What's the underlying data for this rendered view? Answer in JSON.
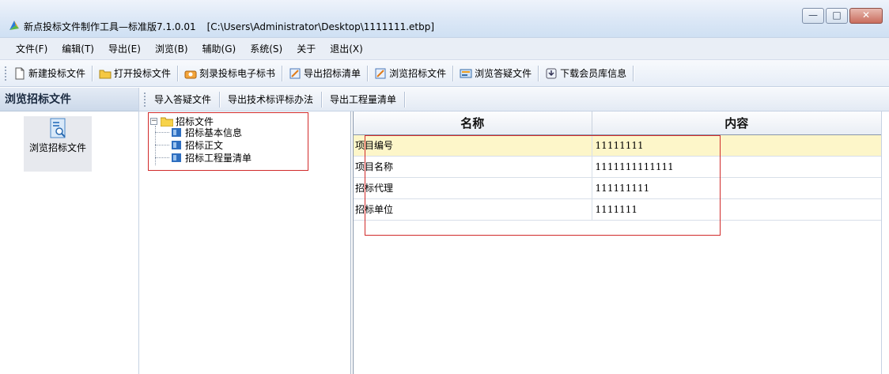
{
  "window": {
    "title": "新点投标文件制作工具—标准版7.1.0.01",
    "path": "[C:\\Users\\Administrator\\Desktop\\1111111.etbp]",
    "controls": {
      "minimize": "—",
      "maximize": "□",
      "close": "✕"
    }
  },
  "menu": {
    "items": [
      "文件(F)",
      "编辑(T)",
      "导出(E)",
      "浏览(B)",
      "辅助(G)",
      "系统(S)",
      "关于",
      "退出(X)"
    ]
  },
  "toolbar": {
    "buttons": [
      {
        "label": "新建投标文件",
        "icon": "new-document-icon"
      },
      {
        "label": "打开投标文件",
        "icon": "open-folder-icon"
      },
      {
        "label": "刻录投标电子标书",
        "icon": "burn-disc-icon"
      },
      {
        "label": "导出招标清单",
        "icon": "export-list-icon"
      },
      {
        "label": "浏览招标文件",
        "icon": "browse-document-icon"
      },
      {
        "label": "浏览答疑文件",
        "icon": "browse-qa-icon"
      },
      {
        "label": "下载会员库信息",
        "icon": "download-member-icon"
      }
    ]
  },
  "left_panel": {
    "header": "浏览招标文件",
    "nav_item": {
      "label": "浏览招标文件",
      "icon": "browse-document-icon"
    }
  },
  "sub_toolbar": {
    "buttons": [
      "导入答疑文件",
      "导出技术标评标办法",
      "导出工程量清单"
    ]
  },
  "tree": {
    "root": {
      "label": "招标文件",
      "expander": "−",
      "icon": "folder-icon"
    },
    "children": [
      {
        "label": "招标基本信息",
        "icon": "doc-icon"
      },
      {
        "label": "招标正文",
        "icon": "doc-icon"
      },
      {
        "label": "招标工程量清单",
        "icon": "doc-icon"
      }
    ]
  },
  "grid": {
    "columns": [
      "名称",
      "内容"
    ],
    "rows": [
      {
        "name": "项目编号",
        "content": "11111111",
        "selected": true
      },
      {
        "name": "项目名称",
        "content": "1111111111111",
        "selected": false
      },
      {
        "name": "招标代理",
        "content": "111111111",
        "selected": false
      },
      {
        "name": "招标单位",
        "content": "1111111",
        "selected": false
      }
    ]
  },
  "colors": {
    "highlight_box": "#d12a2a",
    "selected_row": "#fdf6c9",
    "chrome": "#dbe7f6"
  }
}
